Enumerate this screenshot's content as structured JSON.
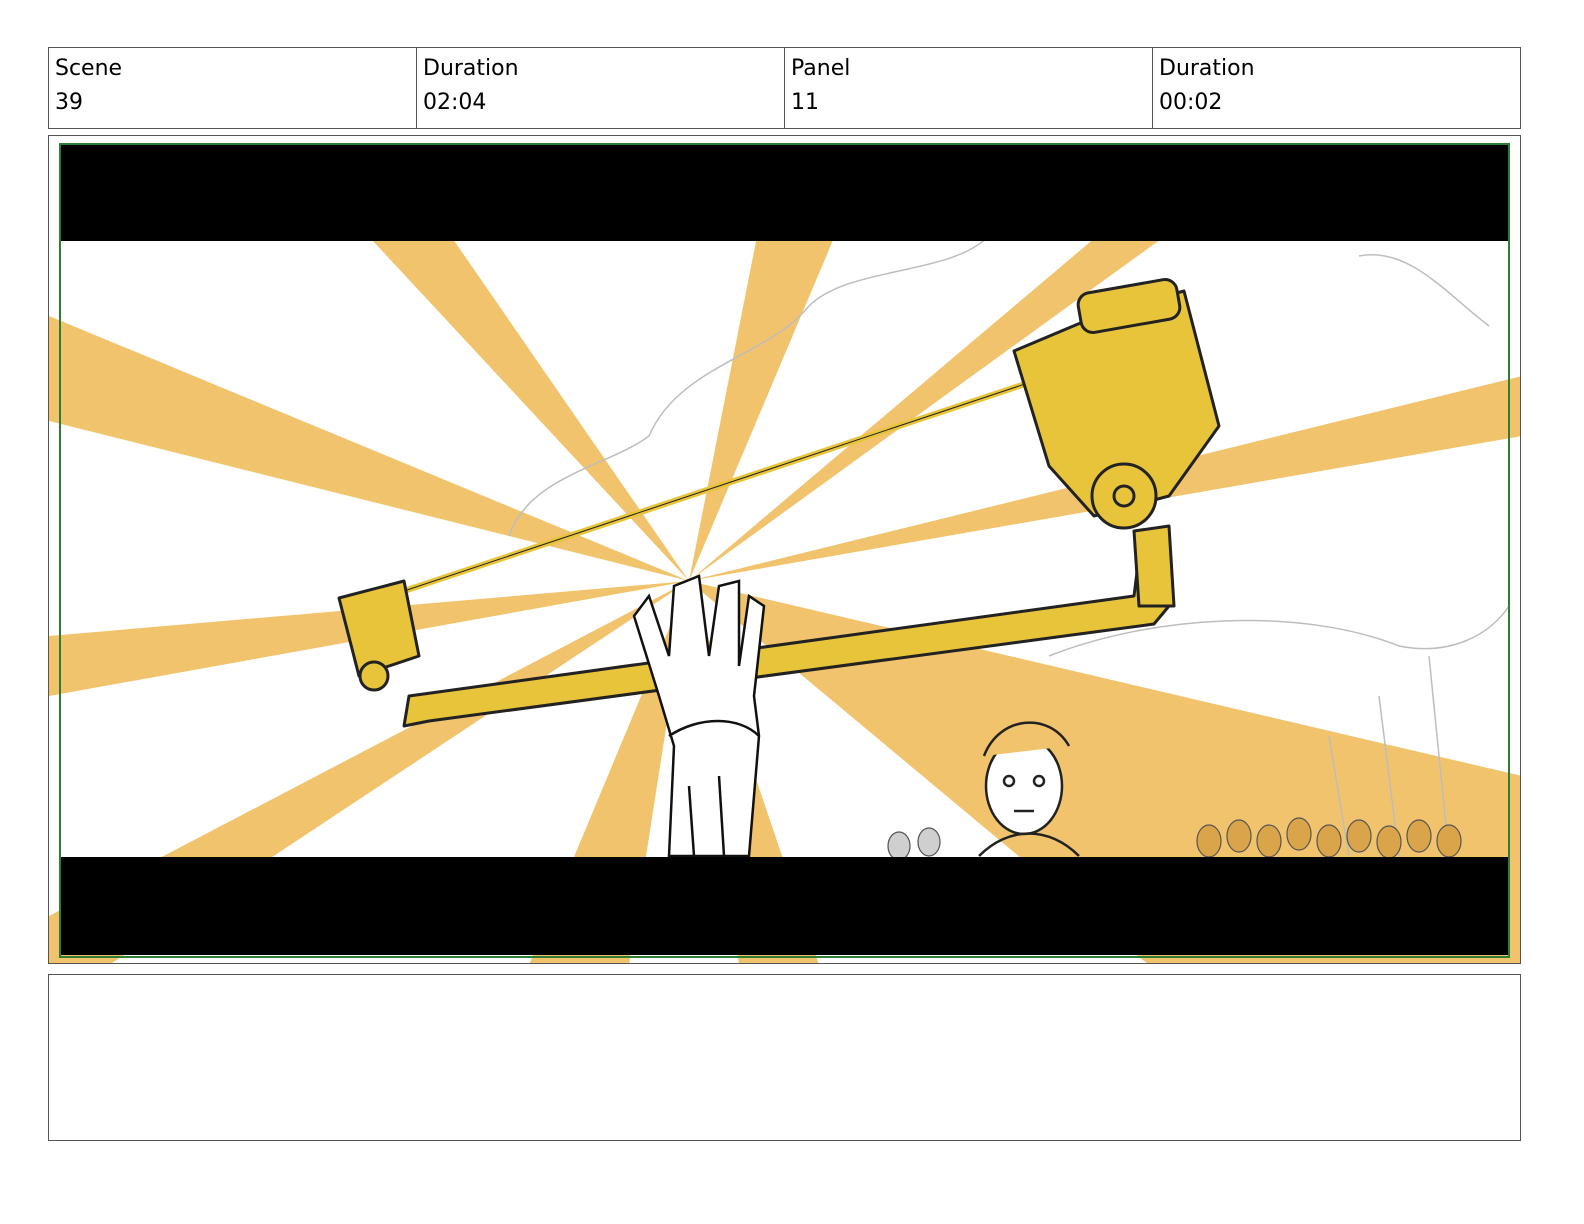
{
  "header": {
    "scene_label": "Scene",
    "scene_value": "39",
    "scene_duration_label": "Duration",
    "scene_duration_value": "02:04",
    "panel_label": "Panel",
    "panel_value": "11",
    "panel_duration_label": "Duration",
    "panel_duration_value": "00:02"
  },
  "notes": {
    "text": ""
  },
  "colors": {
    "ray": "#f2c36d",
    "gold": "#e8c43a",
    "letterbox": "#000000",
    "frame_border": "#2e7d32"
  }
}
